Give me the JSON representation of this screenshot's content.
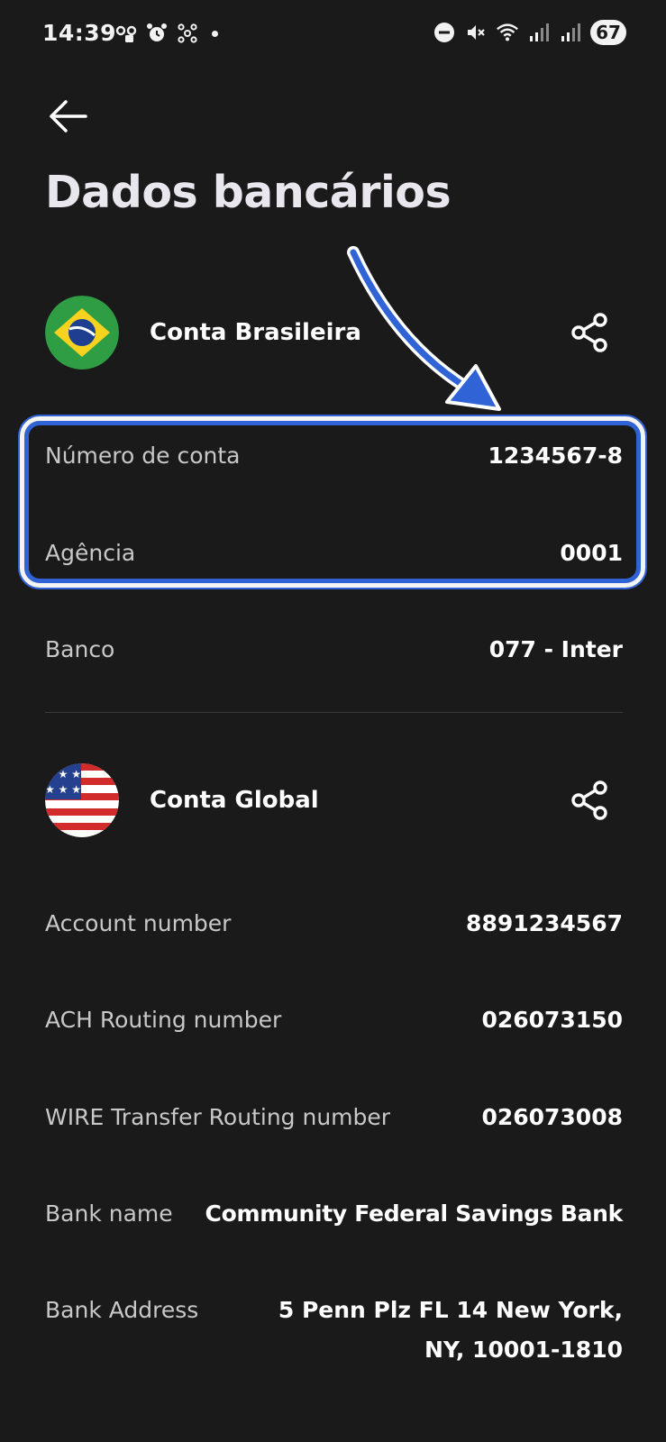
{
  "status_bar": {
    "time": "14:39",
    "battery_level": "67",
    "left_icons": [
      "voicemail-icon",
      "alarm-icon",
      "network-icon",
      "notification-dot"
    ],
    "right_icons": [
      "do-not-disturb-icon",
      "mute-icon",
      "wifi-icon",
      "signal-icon",
      "signal-icon"
    ]
  },
  "page": {
    "title": "Dados bancários"
  },
  "brazil_account": {
    "title": "Conta Brasileira",
    "flag": "brazil-flag",
    "rows": [
      {
        "label": "Número de conta",
        "value": "1234567-8"
      },
      {
        "label": "Agência",
        "value": "0001"
      },
      {
        "label": "Banco",
        "value": "077 - Inter"
      }
    ]
  },
  "global_account": {
    "title": "Conta Global",
    "flag": "usa-flag",
    "rows": [
      {
        "label": "Account number",
        "value": "8891234567"
      },
      {
        "label": "ACH Routing number",
        "value": "026073150"
      },
      {
        "label": "WIRE Transfer Routing number",
        "value": "026073008"
      },
      {
        "label": "Bank name",
        "value": "Community Federal Savings Bank"
      },
      {
        "label": "Bank Address",
        "value": "5 Penn Plz FL 14 New York, NY, 10001-1810"
      }
    ]
  },
  "colors": {
    "background": "#1a1a1a",
    "annotation_blue": "#2f63d6",
    "label_gray": "#c8c8c8"
  }
}
